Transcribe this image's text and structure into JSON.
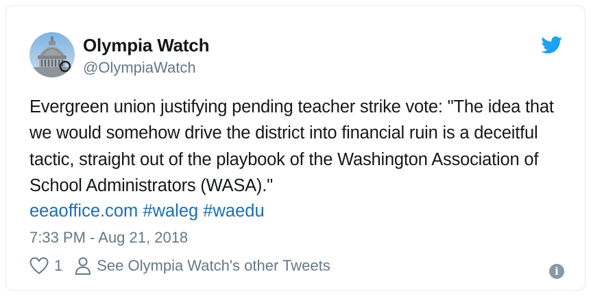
{
  "author": {
    "name": "Olympia Watch",
    "handle": "@OlympiaWatch"
  },
  "tweet": {
    "text": "Evergreen union justifying pending teacher strike vote: \"The idea that we would somehow drive the district into financial ruin is a deceitful tactic, straight out of the playbook of the Washington Association of School Administrators (WASA).\"",
    "link": "eeaoffice.com",
    "hashtags": [
      "#waleg",
      "#waedu"
    ],
    "timestamp": "7:33 PM - Aug 21, 2018"
  },
  "actions": {
    "like_count": "1",
    "see_other_label": "See Olympia Watch's other Tweets"
  },
  "icons": {
    "bird": "twitter-bird-icon",
    "like": "heart-icon",
    "profile": "person-icon",
    "info": "info-icon"
  },
  "colors": {
    "twitter_blue": "#1da1f2",
    "link": "#1b6fb0",
    "secondary_text": "#657786",
    "primary_text": "#14171a"
  }
}
